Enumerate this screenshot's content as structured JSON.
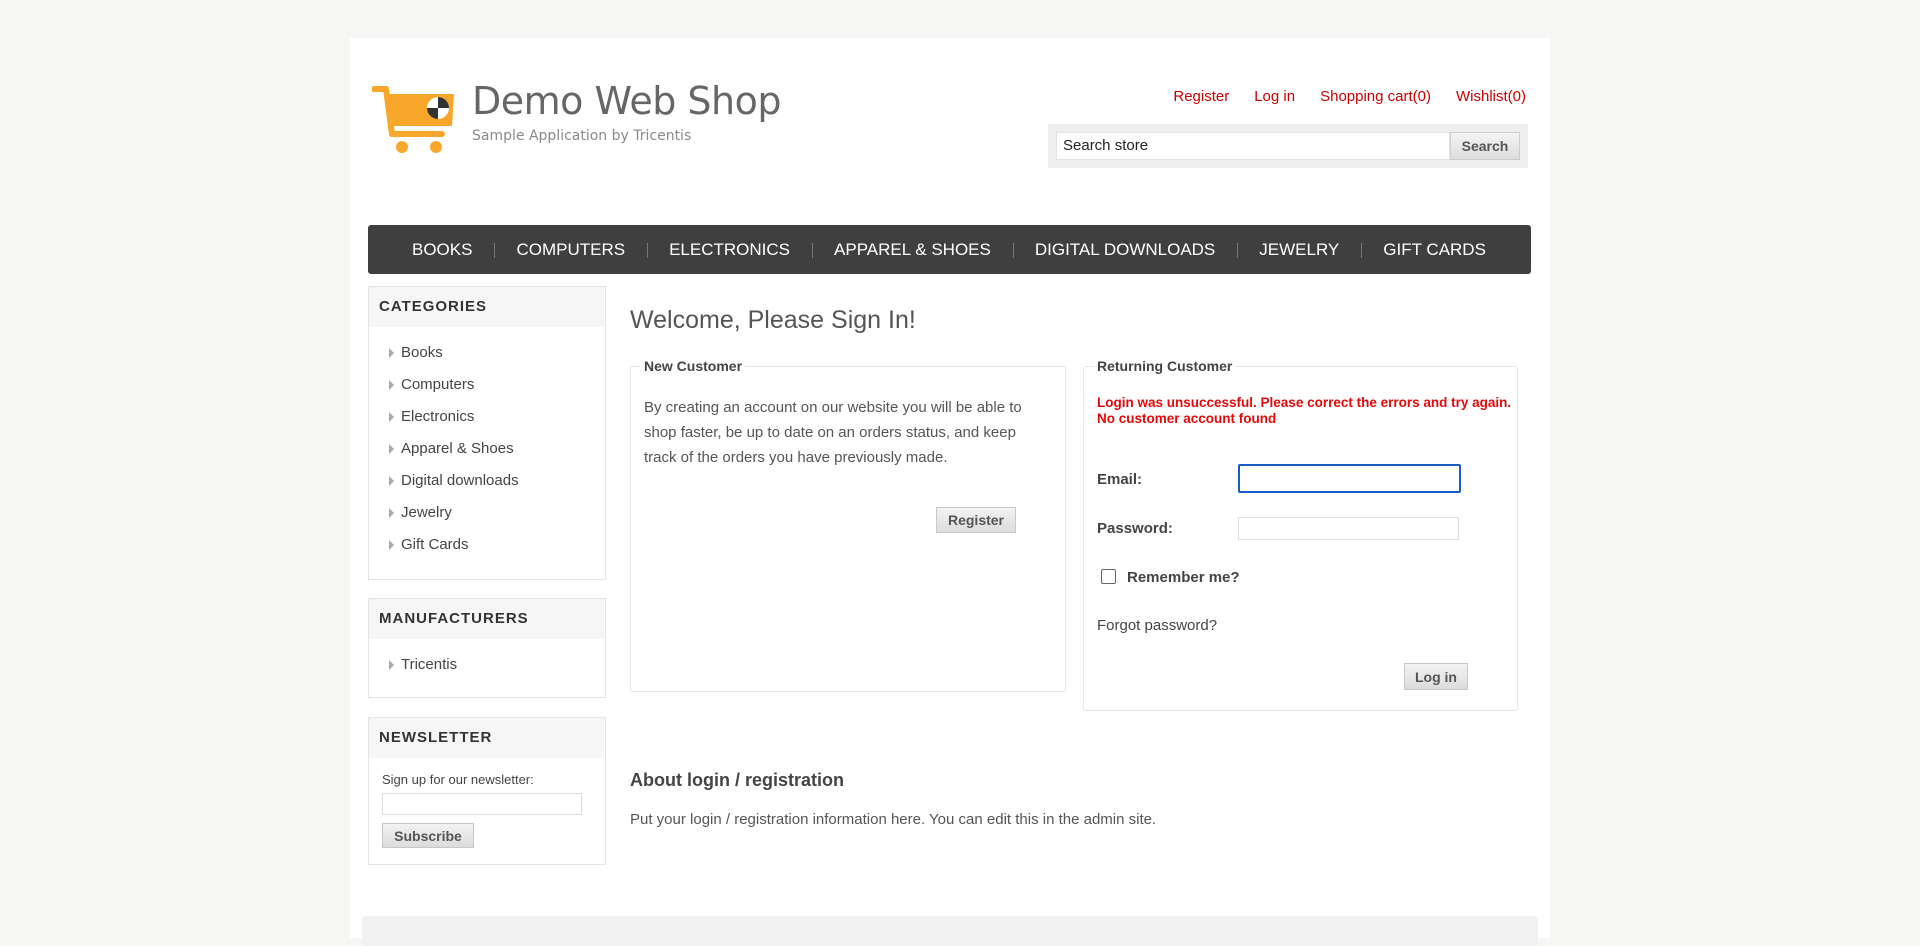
{
  "header": {
    "logo_title": "Demo Web Shop",
    "logo_subtitle": "Sample Application by Tricentis",
    "links": {
      "register": "Register",
      "login": "Log in",
      "cart": "Shopping cart(0)",
      "wishlist": "Wishlist(0)"
    },
    "search": {
      "value": "Search store",
      "button": "Search"
    }
  },
  "top_menu": [
    "BOOKS",
    "COMPUTERS",
    "ELECTRONICS",
    "APPAREL & SHOES",
    "DIGITAL DOWNLOADS",
    "JEWELRY",
    "GIFT CARDS"
  ],
  "sidebar": {
    "categories": {
      "title": "CATEGORIES",
      "items": [
        "Books",
        "Computers",
        "Electronics",
        "Apparel & Shoes",
        "Digital downloads",
        "Jewelry",
        "Gift Cards"
      ]
    },
    "manufacturers": {
      "title": "MANUFACTURERS",
      "items": [
        "Tricentis"
      ]
    },
    "newsletter": {
      "title": "NEWSLETTER",
      "label": "Sign up for our newsletter:",
      "button": "Subscribe"
    }
  },
  "main": {
    "page_title": "Welcome, Please Sign In!",
    "new_customer": {
      "legend": "New Customer",
      "text": "By creating an account on our website you will be able to shop faster, be up to date on an orders status, and keep track of the orders you have previously made.",
      "register_button": "Register"
    },
    "returning_customer": {
      "legend": "Returning Customer",
      "error_line1": "Login was unsuccessful. Please correct the errors and try again.",
      "error_line2": "No customer account found",
      "email_label": "Email:",
      "password_label": "Password:",
      "remember_label": "Remember me?",
      "forgot_link": "Forgot password?",
      "login_button": "Log in"
    },
    "about_title": "About login / registration",
    "about_text": "Put your login / registration information here. You can edit this in the admin site."
  },
  "colors": {
    "accent_red": "#cc0000",
    "error_red": "#e4080a",
    "menu_bg": "#3f3f3f",
    "logo_orange": "#f8a72a",
    "focus_blue": "#1a5bc4"
  }
}
